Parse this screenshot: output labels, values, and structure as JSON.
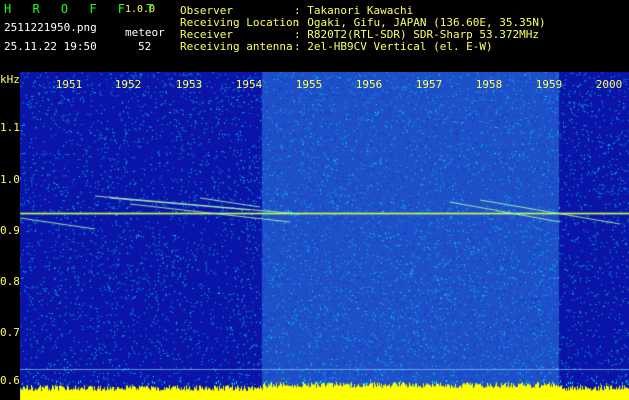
{
  "app": {
    "name": "H R O F F T",
    "version": "1.0.0"
  },
  "file": {
    "name": "2511221950.png",
    "datetime": "25.11.22 19:50"
  },
  "meteor": {
    "label": "meteor",
    "count": "52"
  },
  "info": [
    {
      "label": "Observer",
      "value": ": Takanori Kawachi"
    },
    {
      "label": "Receiving Location",
      "value": ": Ogaki, Gifu, JAPAN (136.60E, 35.35N)"
    },
    {
      "label": "Receiver",
      "value": ": R820T2(RTL-SDR) SDR-Sharp 53.372MHz"
    },
    {
      "label": "Receiving antenna",
      "value": ": 2el-HB9CV Vertical (el. E-W)"
    }
  ],
  "chart_data": {
    "type": "heatmap",
    "ylabel": "kHz",
    "yticks": [
      "1.1",
      "1.0",
      "0.9",
      "0.8",
      "0.7",
      "0.6"
    ],
    "ylim": [
      0.585,
      1.185
    ],
    "columns": [
      "1951",
      "1952",
      "1953",
      "1954",
      "1955",
      "1956",
      "1957",
      "1958",
      "1959",
      "2000"
    ],
    "carrier_khz": 0.912,
    "colors": {
      "background": "#0a14a8",
      "noise": "#00c8ff",
      "bright_band": "#1e50c8",
      "level": "#ffff00",
      "carrier": "#c8ff50"
    }
  }
}
